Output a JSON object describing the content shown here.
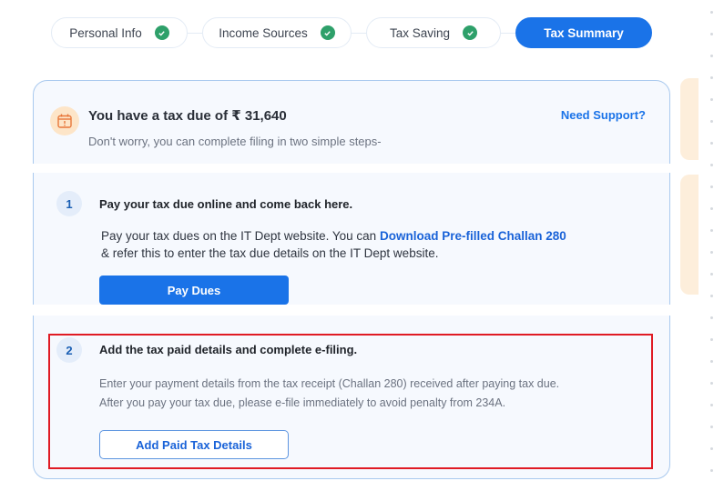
{
  "stepper": {
    "steps": [
      {
        "label": "Personal Info",
        "completed": true,
        "active": false
      },
      {
        "label": "Income Sources",
        "completed": true,
        "active": false
      },
      {
        "label": "Tax Saving",
        "completed": true,
        "active": false
      },
      {
        "label": "Tax Summary",
        "completed": false,
        "active": true
      }
    ]
  },
  "summary": {
    "title": "You have a tax due of ₹ 31,640",
    "subtitle": "Don't worry, you can complete filing in two simple steps-",
    "support_link": "Need Support?",
    "icon": "calendar-alert-icon"
  },
  "steps": [
    {
      "number": "1",
      "title": "Pay your tax due online and come back here.",
      "body_prefix": "Pay your tax dues on the IT Dept website. You can ",
      "body_link": "Download Pre-filled Challan 280",
      "body_suffix": "& refer this to enter the tax due details on the IT Dept website.",
      "button": "Pay Dues"
    },
    {
      "number": "2",
      "title": "Add the tax paid details and complete e-filing.",
      "body_line1": "Enter your payment details from the tax receipt (Challan 280) received after paying tax due.",
      "body_line2": "After you pay your tax due, please e-file immediately to avoid penalty from 234A.",
      "button": "Add Paid Tax Details"
    }
  ],
  "colors": {
    "accent": "#1a73e8",
    "success": "#2ea06a",
    "highlight": "#e01b24"
  }
}
